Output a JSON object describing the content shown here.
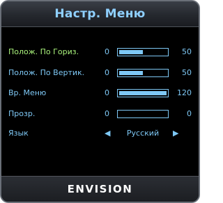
{
  "title": "Настр. Меню",
  "brand": "ENVISION",
  "colors": {
    "accent": "#7ec8f5",
    "active": "#a8f07a",
    "background": "#000000"
  },
  "items": [
    {
      "label": "Полож. По Гориз.",
      "min": "0",
      "value_fraction": 0.5,
      "max": "50",
      "active": true
    },
    {
      "label": "Полож. По Вертик.",
      "min": "0",
      "value_fraction": 0.5,
      "max": "50",
      "active": false
    },
    {
      "label": "Вр. Меню",
      "min": "0",
      "value_fraction": 1.0,
      "max": "120",
      "active": false
    },
    {
      "label": "Прозр.",
      "min": "0",
      "value_fraction": 0.0,
      "max": "0",
      "active": false
    }
  ],
  "language": {
    "label": "Язык",
    "left_arrow": "◀",
    "value": "Русский",
    "right_arrow": "▶"
  }
}
